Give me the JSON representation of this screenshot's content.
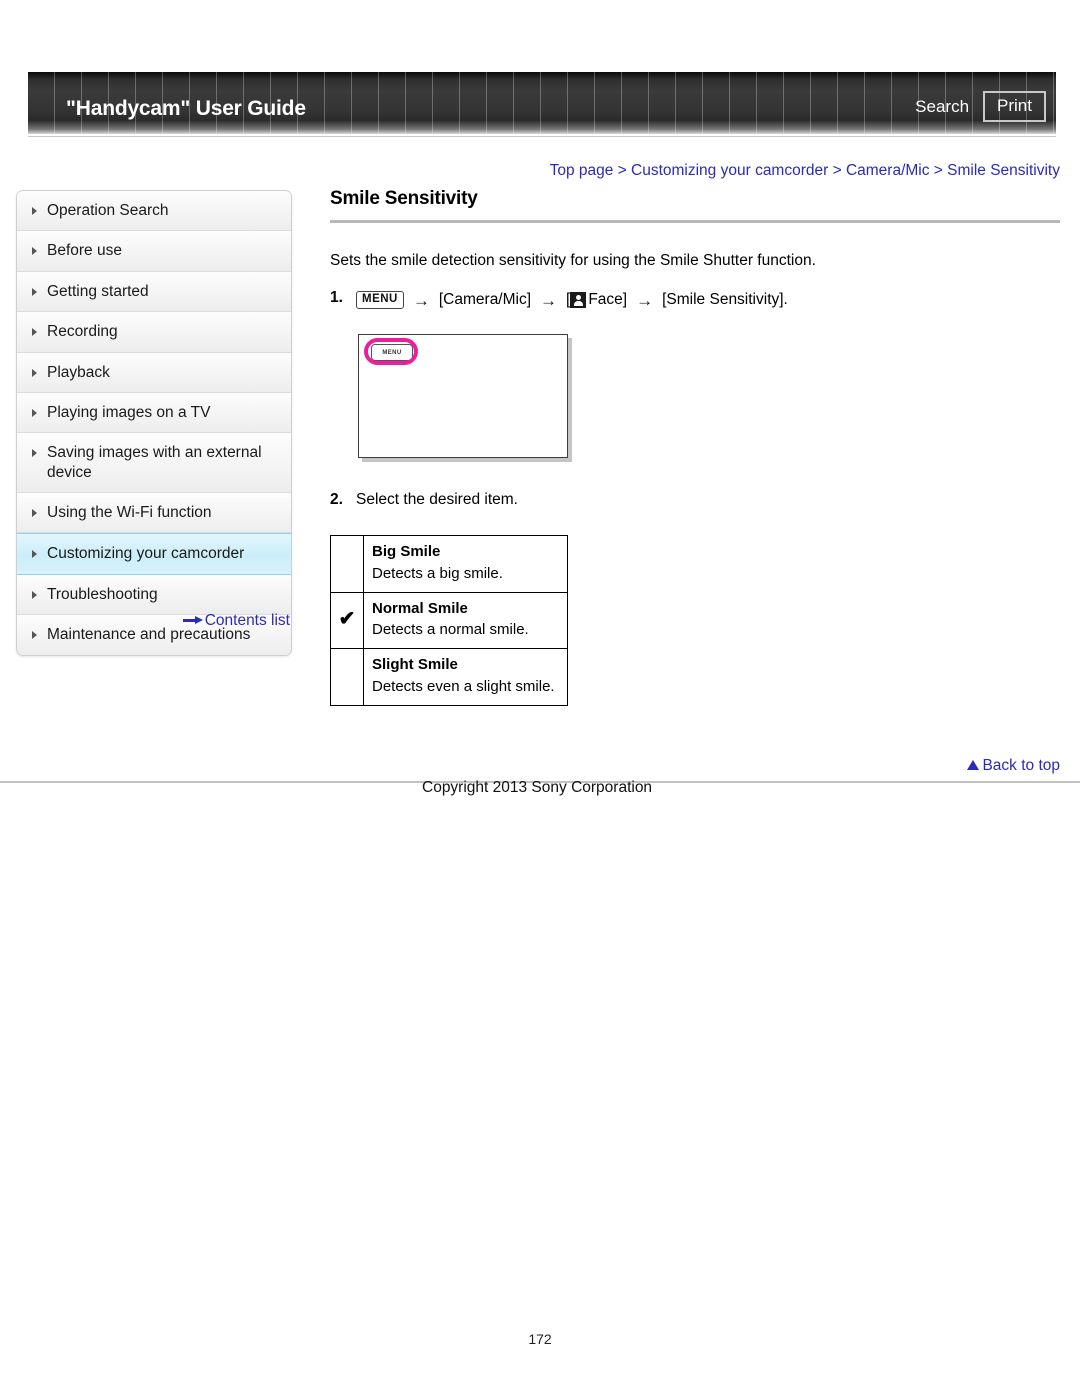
{
  "header": {
    "title": "\"Handycam\" User Guide",
    "search_label": "Search",
    "print_label": "Print"
  },
  "breadcrumb": {
    "text": "Top page > Customizing your camcorder > Camera/Mic > Smile Sensitivity"
  },
  "sidebar": {
    "items": [
      {
        "label": "Operation Search",
        "active": false
      },
      {
        "label": "Before use",
        "active": false
      },
      {
        "label": "Getting started",
        "active": false
      },
      {
        "label": "Recording",
        "active": false
      },
      {
        "label": "Playback",
        "active": false
      },
      {
        "label": "Playing images on a TV",
        "active": false
      },
      {
        "label": "Saving images with an external device",
        "active": false
      },
      {
        "label": "Using the Wi-Fi function",
        "active": false
      },
      {
        "label": "Customizing your camcorder",
        "active": true
      },
      {
        "label": "Troubleshooting",
        "active": false
      },
      {
        "label": "Maintenance and precautions",
        "active": false
      }
    ],
    "contents_list_label": "Contents list"
  },
  "main": {
    "title": "Smile Sensitivity",
    "intro": "Sets the smile detection sensitivity for using the Smile Shutter function.",
    "step1": {
      "number": "1.",
      "menu_chip": "MENU",
      "arrow": "→",
      "part_camera_mic": "[Camera/Mic]",
      "bracket_open": "[",
      "face_label": "Face]",
      "part_smile_sensitivity": "[Smile Sensitivity]."
    },
    "screen_mock": {
      "menu_button_label": "MENU",
      "highlight_color": "#ec1e9c"
    },
    "step2": {
      "number": "2.",
      "text": "Select the desired item."
    },
    "options": [
      {
        "selected": "",
        "name": "Big Smile",
        "desc": "Detects a big smile."
      },
      {
        "selected": "✔",
        "name": "Normal Smile",
        "desc": "Detects a normal smile."
      },
      {
        "selected": "",
        "name": "Slight Smile",
        "desc": "Detects even a slight smile."
      }
    ]
  },
  "footer": {
    "back_to_top": "Back to top",
    "copyright": "Copyright 2013 Sony Corporation",
    "page_number": "172"
  },
  "colors": {
    "link_blue": "#2b2bb5",
    "active_nav": "#cbeef9",
    "highlight_magenta": "#ec1e9c"
  }
}
